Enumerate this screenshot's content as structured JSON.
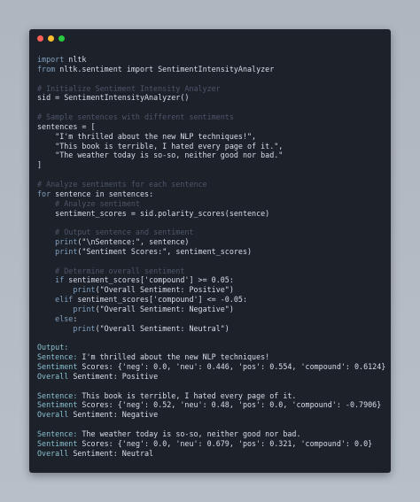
{
  "window": {
    "controls": {
      "close_color": "#ff5f57",
      "minimize_color": "#febc2e",
      "maximize_color": "#28c840"
    }
  },
  "code_lines": [
    {
      "pre": "",
      "kw": "import",
      "rest": " nltk"
    },
    {
      "pre": "",
      "kw": "from",
      "rest": " nltk.sentiment import SentimentIntensityAnalyzer"
    },
    {
      "text": ""
    },
    {
      "comment": "# Initialize Sentiment Intensity Analyzer"
    },
    {
      "text": "sid = SentimentIntensityAnalyzer()"
    },
    {
      "text": ""
    },
    {
      "comment": "# Sample sentences with different sentiments"
    },
    {
      "text": "sentences = ["
    },
    {
      "text": "    \"I'm thrilled about the new NLP techniques!\","
    },
    {
      "text": "    \"This book is terrible, I hated every page of it.\","
    },
    {
      "text": "    \"The weather today is so-so, neither good nor bad.\""
    },
    {
      "text": "]"
    },
    {
      "text": ""
    },
    {
      "comment": "# Analyze sentiments for each sentence"
    },
    {
      "pre": "",
      "kw": "for",
      "rest": " sentence in sentences:"
    },
    {
      "comment": "    # Analyze sentiment"
    },
    {
      "text": "    sentiment_scores = sid.polarity_scores(sentence)"
    },
    {
      "text": ""
    },
    {
      "comment": "    # Output sentence and sentiment"
    },
    {
      "pre": "    ",
      "kw": "print",
      "rest": "(\"\\nSentence:\", sentence)"
    },
    {
      "pre": "    ",
      "kw": "print",
      "rest": "(\"Sentiment Scores:\", sentiment_scores)"
    },
    {
      "text": ""
    },
    {
      "comment": "    # Determine overall sentiment"
    },
    {
      "pre": "    ",
      "kw": "if",
      "rest": " sentiment_scores['compound'] >= 0.05:"
    },
    {
      "pre": "        ",
      "kw": "print",
      "rest": "(\"Overall Sentiment: Positive\")"
    },
    {
      "pre": "    ",
      "kw": "elif",
      "rest": " sentiment_scores['compound'] <= -0.05:"
    },
    {
      "pre": "        ",
      "kw": "print",
      "rest": "(\"Overall Sentiment: Negative\")"
    },
    {
      "pre": "    ",
      "kw": "else",
      "rest": ":"
    },
    {
      "pre": "        ",
      "kw": "print",
      "rest": "(\"Overall Sentiment: Neutral\")"
    },
    {
      "text": ""
    },
    {
      "out": "Output:",
      "rest": ""
    },
    {
      "out": "Sentence:",
      "rest": " I'm thrilled about the new NLP techniques!"
    },
    {
      "out": "Sentiment",
      "rest": " Scores: {'neg': 0.0, 'neu': 0.446, 'pos': 0.554, 'compound': 0.6124}"
    },
    {
      "out": "Overall",
      "rest": " Sentiment: Positive"
    },
    {
      "text": ""
    },
    {
      "out": "Sentence:",
      "rest": " This book is terrible, I hated every page of it."
    },
    {
      "out": "Sentiment",
      "rest": " Scores: {'neg': 0.52, 'neu': 0.48, 'pos': 0.0, 'compound': -0.7906}"
    },
    {
      "out": "Overall",
      "rest": " Sentiment: Negative"
    },
    {
      "text": ""
    },
    {
      "out": "Sentence:",
      "rest": " The weather today is so-so, neither good nor bad."
    },
    {
      "out": "Sentiment",
      "rest": " Scores: {'neg': 0.0, 'neu': 0.679, 'pos': 0.321, 'compound': 0.0}"
    },
    {
      "out": "Overall",
      "rest": " Sentiment: Neutral"
    }
  ]
}
